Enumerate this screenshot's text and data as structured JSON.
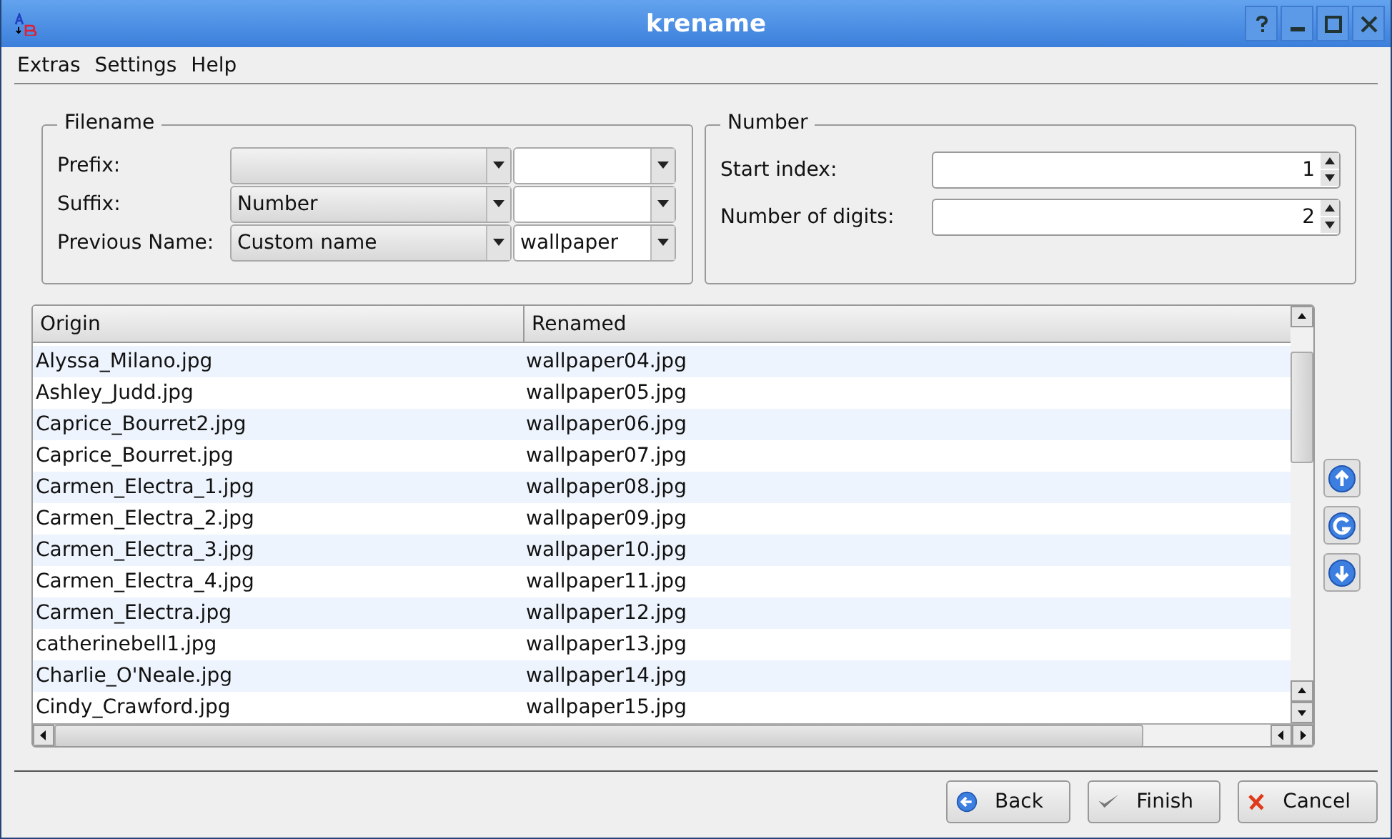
{
  "window": {
    "title": "krename"
  },
  "menu": [
    {
      "label": "Extras"
    },
    {
      "label": "Settings"
    },
    {
      "label": "Help"
    }
  ],
  "filename_group": {
    "title": "Filename",
    "rows": [
      {
        "label": "Prefix:"
      },
      {
        "label": "Suffix:",
        "combo": "Number"
      },
      {
        "label": "Previous Name:",
        "combo": "Custom name",
        "value": "wallpaper"
      }
    ]
  },
  "number_group": {
    "title": "Number",
    "fields": [
      {
        "label": "Start index:",
        "value": "1"
      },
      {
        "label": "Number of digits:",
        "value": "2"
      }
    ]
  },
  "table": {
    "columns": [
      "Origin",
      "Renamed"
    ],
    "rows": [
      {
        "origin": "Alyssa_Milano.jpg",
        "renamed": "wallpaper04.jpg"
      },
      {
        "origin": "Ashley_Judd.jpg",
        "renamed": "wallpaper05.jpg"
      },
      {
        "origin": "Caprice_Bourret2.jpg",
        "renamed": "wallpaper06.jpg"
      },
      {
        "origin": "Caprice_Bourret.jpg",
        "renamed": "wallpaper07.jpg"
      },
      {
        "origin": "Carmen_Electra_1.jpg",
        "renamed": "wallpaper08.jpg"
      },
      {
        "origin": "Carmen_Electra_2.jpg",
        "renamed": "wallpaper09.jpg"
      },
      {
        "origin": "Carmen_Electra_3.jpg",
        "renamed": "wallpaper10.jpg"
      },
      {
        "origin": "Carmen_Electra_4.jpg",
        "renamed": "wallpaper11.jpg"
      },
      {
        "origin": "Carmen_Electra.jpg",
        "renamed": "wallpaper12.jpg"
      },
      {
        "origin": "catherinebell1.jpg",
        "renamed": "wallpaper13.jpg"
      },
      {
        "origin": "Charlie_O'Neale.jpg",
        "renamed": "wallpaper14.jpg"
      },
      {
        "origin": "Cindy_Crawford.jpg",
        "renamed": "wallpaper15.jpg"
      }
    ]
  },
  "buttons": [
    {
      "label": "Back",
      "kind": "back"
    },
    {
      "label": "Finish",
      "kind": "finish"
    },
    {
      "label": "Cancel",
      "kind": "cancel"
    }
  ]
}
